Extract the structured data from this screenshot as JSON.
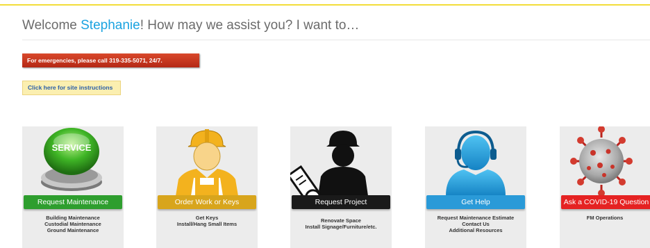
{
  "header": {
    "welcome_prefix": "Welcome ",
    "user_name": "Stephanie",
    "welcome_suffix": "! How may we assist you? I want to…"
  },
  "colors": {
    "accent_line": "#f2dd3a",
    "user_name": "#1aa3e0",
    "emergency_banner": "#c23a1f"
  },
  "emergency_banner": "For emergencies, please call 319-335-5071, 24/7.",
  "instructions_button": "Click here for site instructions",
  "cards": [
    {
      "icon": "service-button-icon",
      "art_text": "SERVICE",
      "button_label": "Request Maintenance",
      "button_color": "#2e9e2e",
      "items": [
        "Building Maintenance",
        "Custodial Maintenance",
        "Ground Maintenance"
      ]
    },
    {
      "icon": "worker-hardhat-icon",
      "button_label": "Order Work or Keys",
      "button_color": "#d8a51c",
      "items": [
        "Get Keys",
        "Install/Hang Small Items"
      ]
    },
    {
      "icon": "engineer-blueprint-icon",
      "button_label": "Request Project",
      "button_color": "#1a1a1a",
      "items": [
        "Renovate Space",
        "Install Signage/Furniture/etc."
      ]
    },
    {
      "icon": "headset-support-icon",
      "button_label": "Get Help",
      "button_color": "#2a9ad8",
      "items": [
        "Request Maintenance Estimate",
        "Contact Us",
        "Additional Resources"
      ]
    },
    {
      "icon": "covid-virus-icon",
      "button_label": "Ask a COVID-19 Question",
      "button_color": "#e52222",
      "items": [
        "FM Operations"
      ]
    }
  ]
}
